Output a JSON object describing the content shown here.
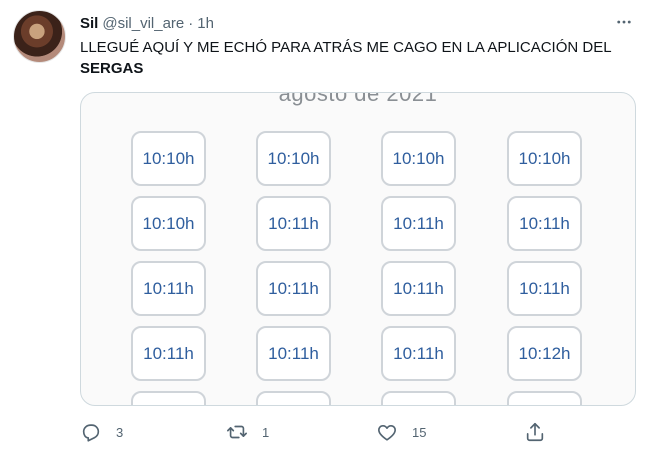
{
  "tweet": {
    "author_name": "Sil",
    "author_handle": "@sil_vil_are",
    "separator": "·",
    "time": "1h",
    "text_plain": "LLEGUÉ AQUÍ Y ME ECHÓ PARA ATRÁS ME CAGO EN LA APLICACIÓN DEL ",
    "text_bold": "SERGAS"
  },
  "media": {
    "caption_partial": "agosto de 2021",
    "slots": [
      "10:10h",
      "10:10h",
      "10:10h",
      "10:10h",
      "10:10h",
      "10:11h",
      "10:11h",
      "10:11h",
      "10:11h",
      "10:11h",
      "10:11h",
      "10:11h",
      "10:11h",
      "10:11h",
      "10:11h",
      "10:12h"
    ]
  },
  "actions": {
    "reply_count": "3",
    "retweet_count": "1",
    "like_count": "15",
    "icons": [
      "reply-icon",
      "retweet-icon",
      "like-icon",
      "share-icon"
    ]
  },
  "colors": {
    "slot_text": "#2f5e9e",
    "slot_border": "#cfd4d9",
    "muted": "#536471"
  }
}
